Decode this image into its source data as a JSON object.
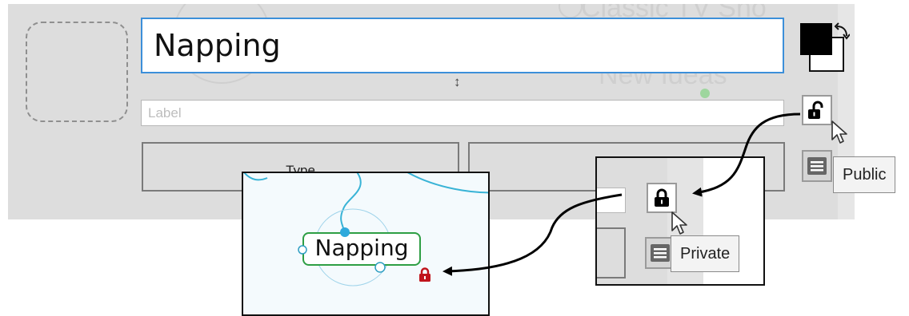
{
  "editor": {
    "topic_text": "Napping",
    "label_placeholder": "Label",
    "type_button_label": "Type",
    "background_texts": {
      "top": "Classic TV Sho",
      "middle": "New Ideas"
    }
  },
  "lock_states": {
    "before_tooltip": "Public",
    "after_tooltip": "Private"
  },
  "map_preview": {
    "node_text": "Napping"
  },
  "colors": {
    "focus_border": "#3c8fd9",
    "node_border": "#2e9e44",
    "connector_line": "#38b3d6",
    "private_lock": "#c0141c",
    "panel_background": "#dddddd"
  },
  "icons": [
    "image-placeholder-icon",
    "resize-vertical-icon",
    "color-swatch-icon",
    "swap-arrow-icon",
    "unlocked-padlock-icon",
    "locked-padlock-icon",
    "menu-lines-icon",
    "mouse-cursor-icon",
    "private-lock-badge-icon"
  ]
}
